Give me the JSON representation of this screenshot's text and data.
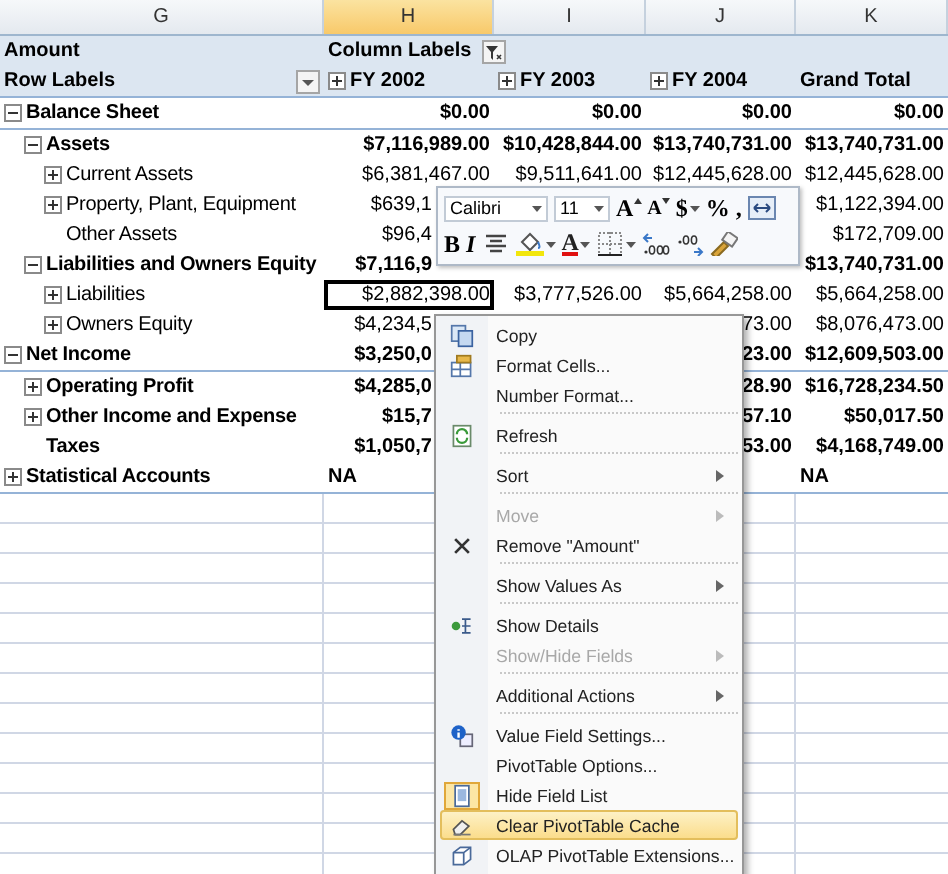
{
  "columns": [
    {
      "letter": "G",
      "selected": false
    },
    {
      "letter": "H",
      "selected": true
    },
    {
      "letter": "I",
      "selected": false
    },
    {
      "letter": "J",
      "selected": false
    },
    {
      "letter": "K",
      "selected": false
    }
  ],
  "pivot": {
    "data_field": "Amount",
    "column_labels": "Column Labels",
    "row_labels": "Row Labels",
    "column_headers": [
      {
        "label": "FY 2002",
        "expanded": false
      },
      {
        "label": "FY 2003",
        "expanded": false
      },
      {
        "label": "FY 2004",
        "expanded": false
      },
      {
        "label": "Grand Total"
      }
    ],
    "rows": [
      {
        "label": "Balance Sheet",
        "kind": "amounts",
        "expanded": true,
        "bold": true,
        "values": {
          "fy_2002": {
            "text": "$0.00",
            "selected": false
          },
          "fy_2003": {
            "text": "$0.00",
            "selected": false
          },
          "fy_2004": {
            "text": "$0.00",
            "selected": false
          },
          "grand_total": {
            "text": "$0.00",
            "selected": false
          }
        },
        "children": [
          {
            "label": "Assets",
            "kind": "amounts",
            "expanded": true,
            "bold": true,
            "values": {
              "fy_2002": {
                "text": "$7,116,989.00",
                "selected": false
              },
              "fy_2003": {
                "text": "$10,428,844.00",
                "selected": false
              },
              "fy_2004": {
                "text": "$13,740,731.00",
                "selected": false
              },
              "grand_total": {
                "text": "$13,740,731.00",
                "selected": false
              }
            },
            "children": [
              {
                "label": "Current Assets",
                "kind": "amounts",
                "expanded": false,
                "bold": false,
                "values": {
                  "fy_2002": {
                    "text": "$6,381,467.00",
                    "selected": false
                  },
                  "fy_2003": {
                    "text": "$9,511,641.00",
                    "selected": false
                  },
                  "fy_2004": {
                    "text": "$12,445,628.00",
                    "selected": false
                  },
                  "grand_total": {
                    "text": "$12,445,628.00",
                    "selected": false
                  }
                }
              },
              {
                "label": "Property, Plant, Equipment",
                "kind": "amounts",
                "expanded": false,
                "bold": false,
                "values": {
                  "fy_2002": {
                    "text": "$639,1",
                    "selected": false
                  },
                  "grand_total": {
                    "text": "$1,122,394.00",
                    "selected": false
                  }
                }
              },
              {
                "label": "Other Assets",
                "kind": "amounts",
                "bold": false,
                "values": {
                  "fy_2002": {
                    "text": "$96,4",
                    "selected": false
                  },
                  "grand_total": {
                    "text": "$172,709.00",
                    "selected": false
                  }
                }
              }
            ]
          },
          {
            "label": "Liabilities and Owners Equity",
            "kind": "amounts",
            "expanded": true,
            "bold": true,
            "values": {
              "fy_2002": {
                "text": "$7,116,9",
                "selected": false
              },
              "grand_total": {
                "text": "$13,740,731.00",
                "selected": false
              }
            },
            "children": [
              {
                "label": "Liabilities",
                "kind": "amounts",
                "expanded": false,
                "bold": false,
                "values": {
                  "fy_2002": {
                    "text": "$2,882,398.00",
                    "selected": true
                  },
                  "fy_2003": {
                    "text": "$3,777,526.00",
                    "selected": false
                  },
                  "fy_2004": {
                    "text": "$5,664,258.00",
                    "selected": false
                  },
                  "grand_total": {
                    "text": "$5,664,258.00",
                    "selected": false
                  }
                }
              },
              {
                "label": "Owners Equity",
                "kind": "amounts",
                "expanded": false,
                "bold": false,
                "values": {
                  "fy_2002": {
                    "text": "$4,234,5",
                    "selected": false
                  },
                  "fy_2004": {
                    "text": "73.00",
                    "selected": false
                  },
                  "grand_total": {
                    "text": "$8,076,473.00",
                    "selected": false
                  }
                }
              }
            ]
          }
        ]
      },
      {
        "label": "Net Income",
        "kind": "amounts",
        "expanded": true,
        "bold": true,
        "values": {
          "fy_2002": {
            "text": "$3,250,0",
            "selected": false
          },
          "fy_2004": {
            "text": "23.00",
            "selected": false
          },
          "grand_total": {
            "text": "$12,609,503.00",
            "selected": false
          }
        },
        "children": [
          {
            "label": "Operating Profit",
            "kind": "amounts",
            "expanded": false,
            "bold": true,
            "values": {
              "fy_2002": {
                "text": "$4,285,0",
                "selected": false
              },
              "fy_2004": {
                "text": "28.90",
                "selected": false
              },
              "grand_total": {
                "text": "$16,728,234.50",
                "selected": false
              }
            }
          },
          {
            "label": "Other Income and Expense",
            "kind": "amounts",
            "expanded": false,
            "bold": true,
            "values": {
              "fy_2002": {
                "text": "$15,7",
                "selected": false
              },
              "fy_2004": {
                "text": "57.10",
                "selected": false
              },
              "grand_total": {
                "text": "$50,017.50",
                "selected": false
              }
            }
          },
          {
            "label": "Taxes",
            "kind": "amounts",
            "bold": true,
            "values": {
              "fy_2002": {
                "text": "$1,050,7",
                "selected": false
              },
              "fy_2004": {
                "text": "53.00",
                "selected": false
              },
              "grand_total": {
                "text": "$4,168,749.00",
                "selected": false
              }
            }
          }
        ]
      },
      {
        "label": "Statistical Accounts",
        "kind": "text",
        "expanded": false,
        "bold": true,
        "values": {
          "fy_2002": {
            "text": "NA",
            "selected": false
          },
          "grand_total": {
            "text": "NA",
            "selected": false
          }
        }
      }
    ]
  },
  "mini_toolbar": {
    "font_controls": [
      {
        "kind": "combo",
        "text": "Calibri"
      },
      {
        "kind": "combo",
        "text": "11"
      },
      {
        "kind": "glyph",
        "text": "A"
      },
      {
        "kind": "glyph",
        "text": "A"
      },
      {
        "kind": "glyph",
        "text": "$",
        "dropdown": true
      },
      {
        "kind": "glyph",
        "text": "%"
      },
      {
        "kind": "glyph",
        "text": ","
      },
      {
        "kind": "icon"
      }
    ],
    "format_controls": [
      {
        "kind": "glyph",
        "text": "B"
      },
      {
        "kind": "glyph",
        "text": "I"
      },
      {
        "kind": "icon"
      },
      {
        "kind": "icon",
        "dropdown": true
      },
      {
        "kind": "glyph",
        "text": "A",
        "dropdown": true
      },
      {
        "kind": "icon",
        "dropdown": true
      },
      {
        "kind": "icon"
      },
      {
        "kind": "icon"
      },
      {
        "kind": "icon"
      }
    ]
  },
  "context_menu": {
    "items": [
      {
        "kind": "item",
        "label": "Copy",
        "disabled": false,
        "submenu": false,
        "checked": false,
        "selected": false
      },
      {
        "kind": "item",
        "label": "Format Cells...",
        "disabled": false,
        "submenu": false,
        "checked": false,
        "selected": false
      },
      {
        "kind": "item",
        "label": "Number Format...",
        "disabled": false,
        "submenu": false,
        "checked": false,
        "selected": false
      },
      {
        "kind": "separator"
      },
      {
        "kind": "item",
        "label": "Refresh",
        "disabled": false,
        "submenu": false,
        "checked": false,
        "selected": false
      },
      {
        "kind": "separator"
      },
      {
        "kind": "item",
        "label": "Sort",
        "disabled": false,
        "submenu": true,
        "checked": false,
        "selected": false
      },
      {
        "kind": "separator"
      },
      {
        "kind": "item",
        "label": "Move",
        "disabled": true,
        "submenu": true,
        "checked": false,
        "selected": false
      },
      {
        "kind": "item",
        "label": "Remove \"Amount\"",
        "disabled": false,
        "submenu": false,
        "checked": false,
        "selected": false
      },
      {
        "kind": "separator"
      },
      {
        "kind": "item",
        "label": "Show Values As",
        "disabled": false,
        "submenu": true,
        "checked": false,
        "selected": false
      },
      {
        "kind": "separator"
      },
      {
        "kind": "item",
        "label": "Show Details",
        "disabled": false,
        "submenu": false,
        "checked": false,
        "selected": false
      },
      {
        "kind": "item",
        "label": "Show/Hide Fields",
        "disabled": true,
        "submenu": true,
        "checked": false,
        "selected": false
      },
      {
        "kind": "separator"
      },
      {
        "kind": "item",
        "label": "Additional Actions",
        "disabled": false,
        "submenu": true,
        "checked": false,
        "selected": false
      },
      {
        "kind": "separator"
      },
      {
        "kind": "item",
        "label": "Value Field Settings...",
        "disabled": false,
        "submenu": false,
        "checked": false,
        "selected": false
      },
      {
        "kind": "item",
        "label": "PivotTable Options...",
        "disabled": false,
        "submenu": false,
        "checked": false,
        "selected": false
      },
      {
        "kind": "item",
        "label": "Hide Field List",
        "disabled": false,
        "submenu": false,
        "checked": true,
        "selected": false
      },
      {
        "kind": "item",
        "label": "Clear PivotTable Cache",
        "disabled": false,
        "submenu": false,
        "checked": false,
        "selected": true
      },
      {
        "kind": "item",
        "label": "OLAP PivotTable Extensions...",
        "disabled": false,
        "submenu": false,
        "checked": false,
        "selected": false
      }
    ]
  }
}
